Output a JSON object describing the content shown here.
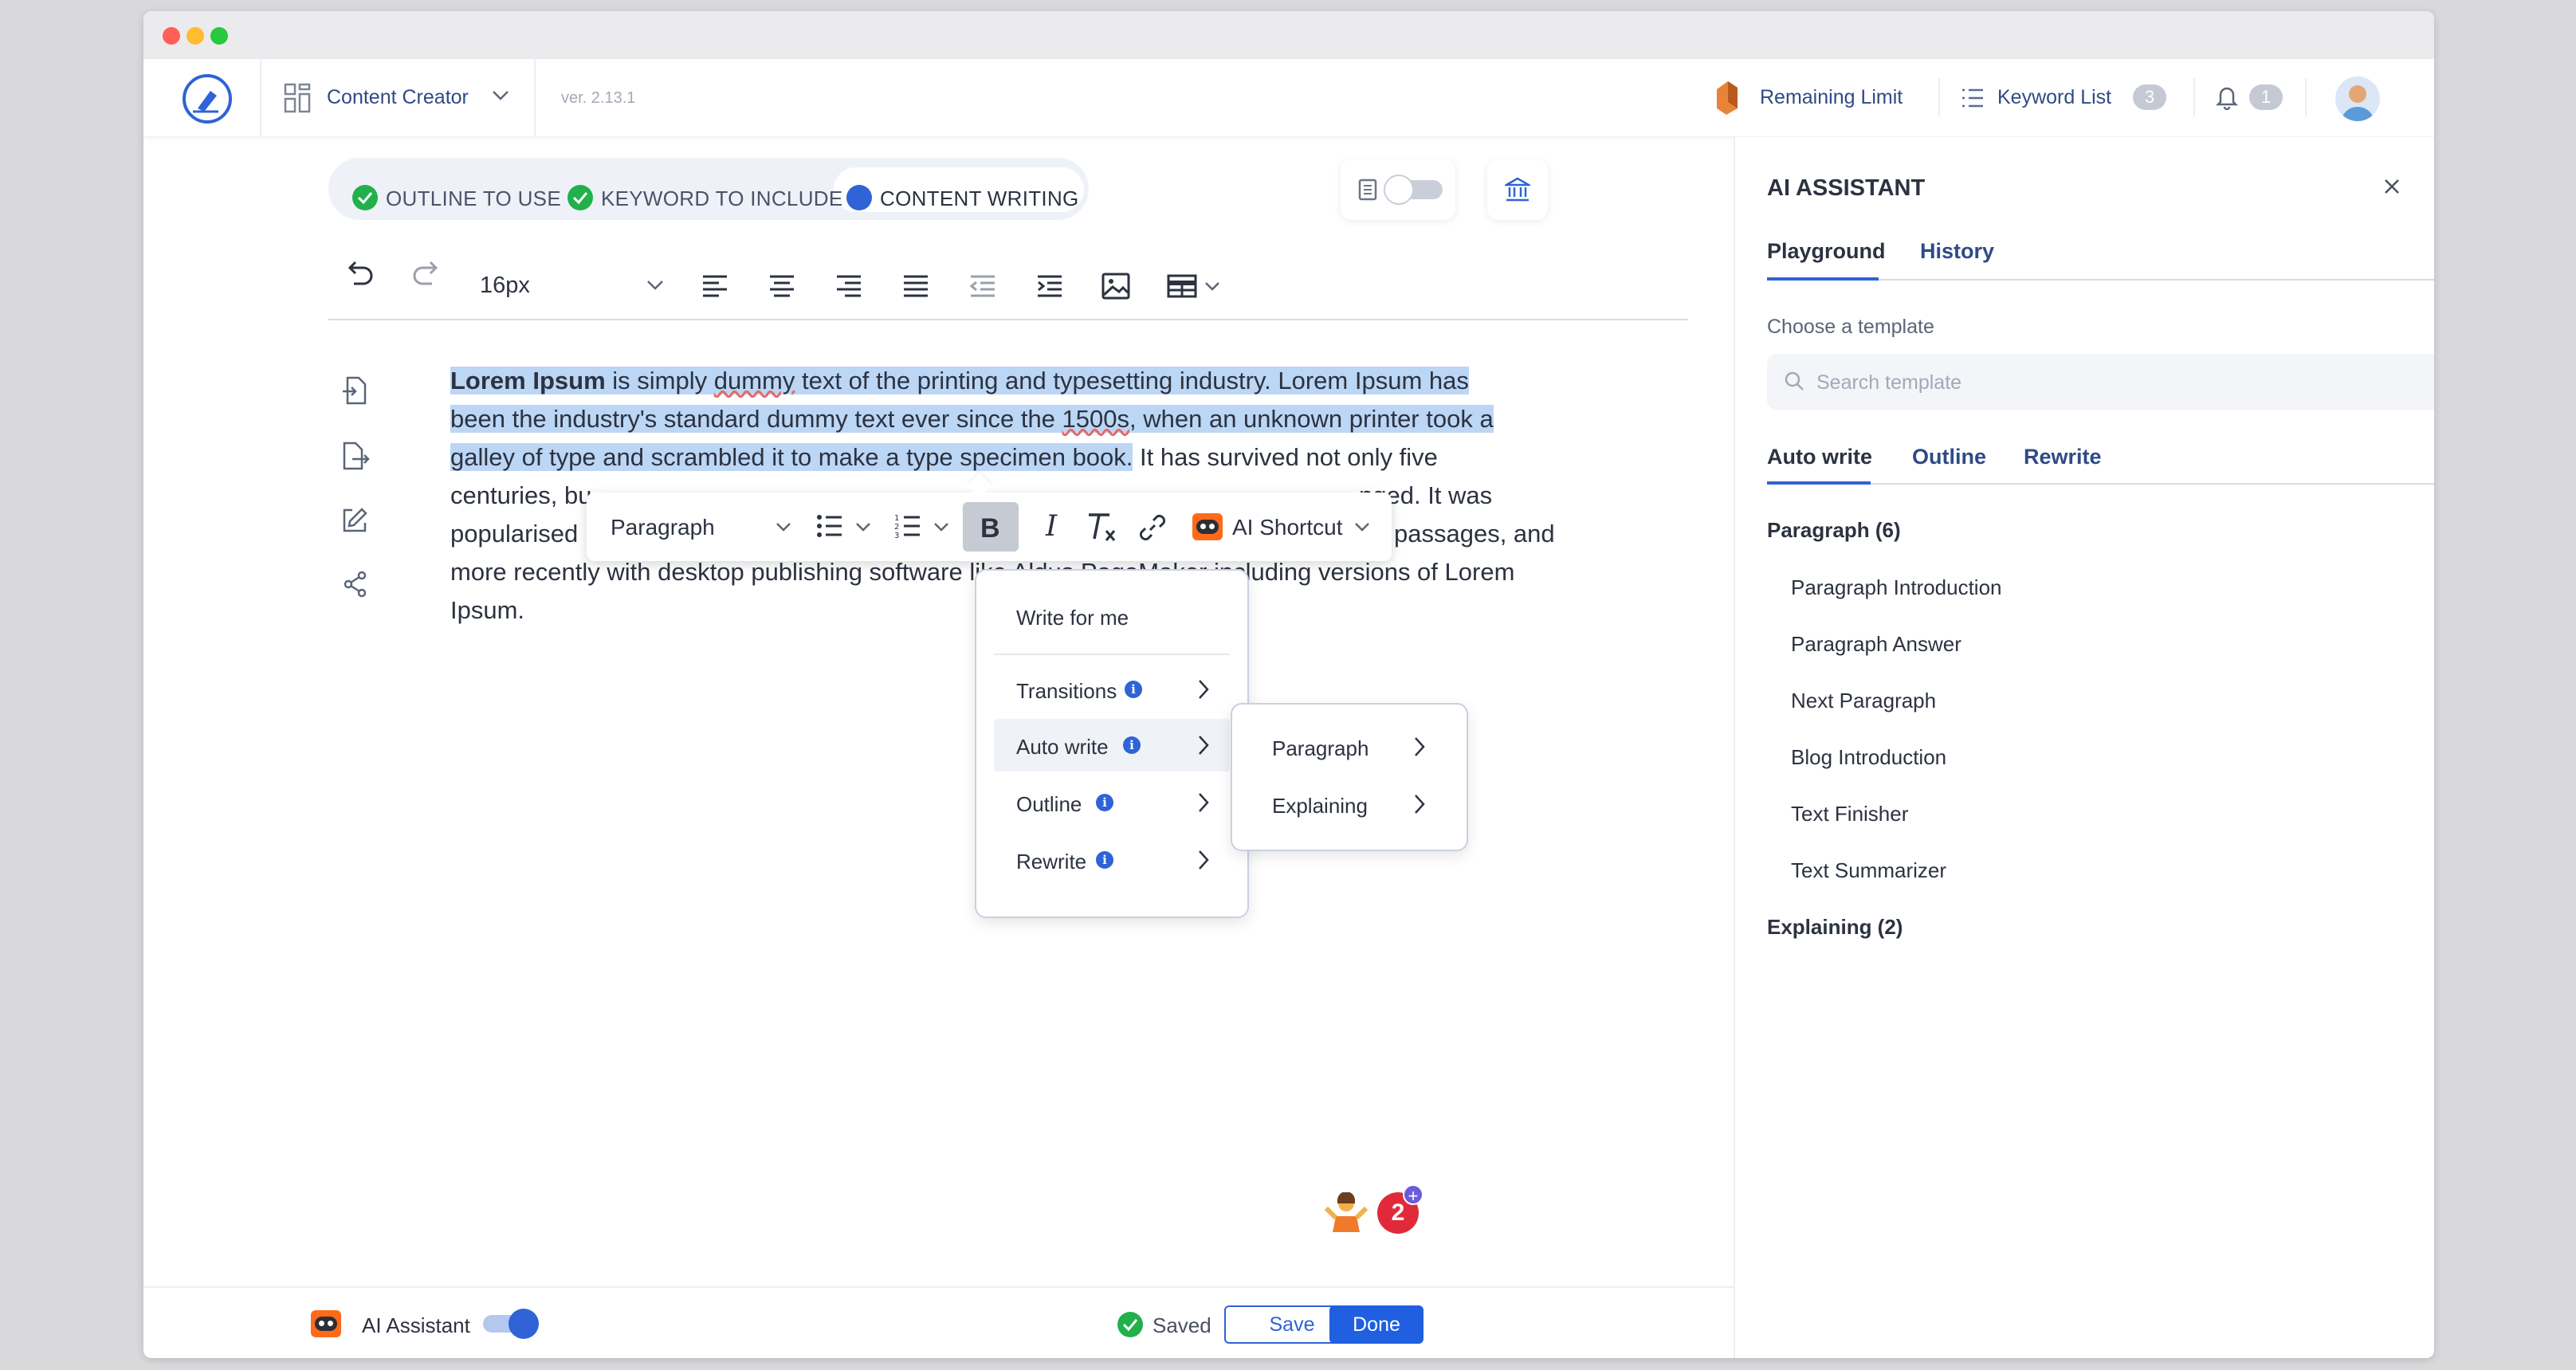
{
  "header": {
    "app_name": "Content Creator",
    "version": "ver. 2.13.1",
    "remaining_limit": "Remaining Limit",
    "keyword_list": "Keyword List",
    "keyword_count": "3",
    "notification_count": "1"
  },
  "steps": [
    {
      "label": "OUTLINE TO USE",
      "state": "done"
    },
    {
      "label": "KEYWORD TO INCLUDE",
      "state": "done"
    },
    {
      "label": "CONTENT WRITING",
      "state": "active"
    }
  ],
  "toolbar": {
    "font_size": "16px"
  },
  "editor": {
    "bold_lead": "Lorem Ipsum",
    "line1a": " is simply ",
    "line1b": "dummy",
    "line1c": " text of the printing and typesetting industry. Lorem Ipsum has",
    "line2a": "been the industry's standard dummy text ever since the ",
    "line2b": "1500s",
    "line2c": ", when an unknown printer took a",
    "line3a": "galley of type and scrambled it to make a type specimen book.",
    "line3b": " It has survived not only five",
    "line4a": "centuries, bu",
    "line4b": "nged. It was",
    "line5a": "popularised",
    "line5b": " passages, and",
    "line6": "more recently with desktop publishing software like Aldus PageMaker including versions of Lorem",
    "line7": "Ipsum."
  },
  "floating_toolbar": {
    "block_type": "Paragraph",
    "ai_shortcut": "AI Shortcut"
  },
  "ai_menu": {
    "write_for_me": "Write for me",
    "items": [
      "Transitions",
      "Auto write",
      "Outline",
      "Rewrite"
    ],
    "submenu": [
      "Paragraph",
      "Explaining"
    ]
  },
  "panel": {
    "title": "AI ASSISTANT",
    "tabs": [
      "Playground",
      "History"
    ],
    "choose_template": "Choose a template",
    "search_placeholder": "Search template",
    "subtabs": [
      "Auto write",
      "Outline",
      "Rewrite"
    ],
    "group1_title": "Paragraph (6)",
    "group1_items": [
      "Paragraph Introduction",
      "Paragraph Answer",
      "Next Paragraph",
      "Blog Introduction",
      "Text Finisher",
      "Text Summarizer"
    ],
    "group2_title": "Explaining (2)"
  },
  "bottom": {
    "ai_assistant": "AI Assistant",
    "saved": "Saved",
    "save": "Save",
    "done": "Done",
    "counter": "2"
  },
  "colors": {
    "accent": "#2f63d6",
    "brand_text": "#2f4a86",
    "selection": "#bcd6f5",
    "success": "#22b04b",
    "danger": "#e02a3a"
  }
}
